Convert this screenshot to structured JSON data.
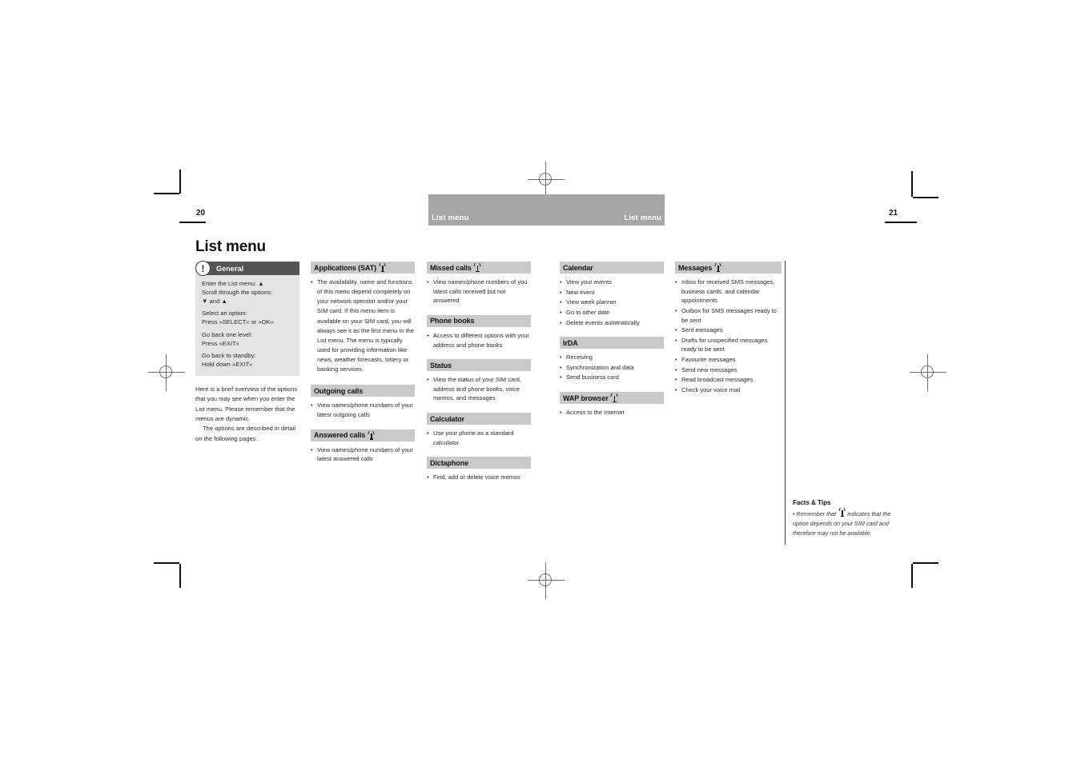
{
  "document": {
    "running_head_left": "List menu",
    "running_head_right": "List menu",
    "folio_left": "20",
    "folio_right": "21",
    "page_title": "List menu",
    "sim_icon_name": "sim-dependent-icon",
    "colors": {
      "header_bar": "#a6a6a6",
      "section_header": "#c9c9c9",
      "callout_header": "#555555",
      "callout_body": "#e4e4e4",
      "text": "#2a2a2a"
    }
  },
  "general": {
    "header_label": "General",
    "icon": "exclamation-circle-icon",
    "lines": [
      "Enter the List menu:  ▲\nScroll through the options:\n   ▼  and  ▲",
      "Select an option:\nPress »SELECT« or »OK«",
      "Go back one level:\nPress »EXIT«",
      "Go back to standby:\nHold down »EXIT«"
    ]
  },
  "intro": {
    "paragraph_1": "Here is a brief overview of the options that you may see when you enter the List menu. Please remember that the menus are dynamic.",
    "paragraph_2": "The options are described in detail on the following pages."
  },
  "sections": {
    "applications_sat": {
      "title": "Applications (SAT)",
      "sim_dependent": true,
      "items": [
        "The availability, name and functions of this menu depend completely on your network operator and/or your SIM card. If this menu item is available on your SIM card, you will always see it as the first menu in the List menu. The menu is typically used for providing information like news, weather forecasts, lottery or banking services."
      ]
    },
    "outgoing_calls": {
      "title": "Outgoing calls",
      "sim_dependent": false,
      "items": [
        "View names/phone numbers of your latest outgoing calls"
      ]
    },
    "answered_calls": {
      "title": "Answered calls",
      "sim_dependent": true,
      "items": [
        "View names/phone numbers of your latest answered calls"
      ]
    },
    "missed_calls": {
      "title": "Missed calls",
      "sim_dependent": true,
      "items": [
        "View names/phone numbers of you latest calls received but not answered"
      ]
    },
    "phone_books": {
      "title": "Phone books",
      "sim_dependent": false,
      "items": [
        "Access to different options with your address and phone books"
      ]
    },
    "status": {
      "title": "Status",
      "sim_dependent": false,
      "items": [
        "View the status of your SIM card, address and phone books, voice memos, and messages"
      ]
    },
    "calculator": {
      "title": "Calculator",
      "sim_dependent": false,
      "items": [
        "Use your phone as a standard calculator"
      ]
    },
    "dictaphone": {
      "title": "Dictaphone",
      "sim_dependent": false,
      "items": [
        "Find, add or delete voice memos"
      ]
    },
    "calendar": {
      "title": "Calendar",
      "sim_dependent": false,
      "items": [
        "View your events",
        "New event",
        "View week planner",
        "Go to other date",
        "Delete events automatically"
      ]
    },
    "irda": {
      "title": "IrDA",
      "sim_dependent": false,
      "items": [
        "Receiving",
        "Synchronization and data",
        "Send business card"
      ]
    },
    "wap_browser": {
      "title": "WAP browser",
      "sim_dependent": true,
      "items": [
        "Access to the Internet"
      ]
    },
    "messages": {
      "title": "Messages",
      "sim_dependent": true,
      "items": [
        "Inbox for received SMS messages, business cards, and calendar appointments",
        "Outbox for SMS messages ready to be sent",
        "Sent messages",
        "Drafts for unspecified messages ready to be sent",
        "Favourite messages",
        "Send new messages",
        "Read broadcast messages",
        "Check your voice mail"
      ]
    }
  },
  "facts_and_tips": {
    "title": "Facts & Tips",
    "text_before_icon": "Remember that",
    "text_after_icon": "indicates that the option depends on your SIM card and therefore may not be available."
  }
}
